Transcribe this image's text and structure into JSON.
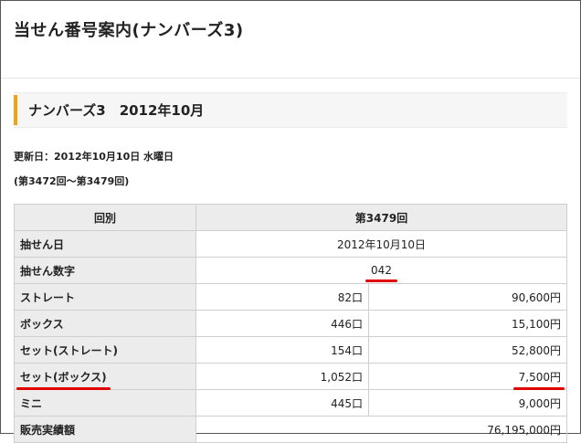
{
  "page": {
    "title": "当せん番号案内(ナンバーズ3)"
  },
  "section": {
    "title": "ナンバーズ3　2012年10月"
  },
  "updated": "更新日：2012年10月10日 水曜日",
  "range": "(第3472回～第3479回)",
  "table": {
    "header": {
      "label": "回別",
      "draw": "第3479回"
    },
    "draw_date": {
      "label": "抽せん日",
      "value": "2012年10月10日"
    },
    "winning_number": {
      "label": "抽せん数字",
      "value": "042"
    },
    "prizes": [
      {
        "label": "ストレート",
        "count": "82口",
        "amount": "90,600円"
      },
      {
        "label": "ボックス",
        "count": "446口",
        "amount": "15,100円"
      },
      {
        "label": "セット(ストレート)",
        "count": "154口",
        "amount": "52,800円"
      },
      {
        "label": "セット(ボックス)",
        "count": "1,052口",
        "amount": "7,500円"
      },
      {
        "label": "ミニ",
        "count": "445口",
        "amount": "9,000円"
      }
    ],
    "sales": {
      "label": "販売実績額",
      "value": "76,195,000円"
    }
  },
  "colors": {
    "accent": "#f0a30a",
    "annotation_red": "#e00000",
    "header_bg": "#ececec"
  }
}
